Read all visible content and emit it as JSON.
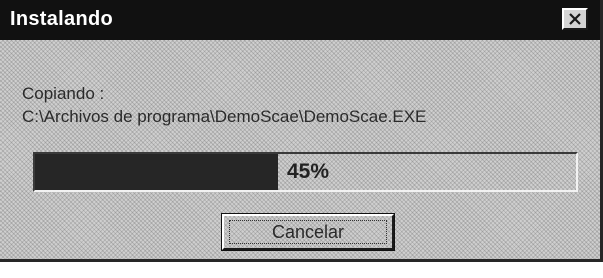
{
  "window": {
    "title": "Instalando",
    "close_icon": "close-icon"
  },
  "body": {
    "status_label": "Copiando :",
    "current_file": "C:\\Archivos de programa\\DemoScae\\DemoScae.EXE"
  },
  "progress": {
    "value": 0.45,
    "label": "45%"
  },
  "buttons": {
    "cancel_label": "Cancelar"
  },
  "colors": {
    "title_bar": "#111111",
    "progress_fill": "#262626",
    "dialog_face": "#cfcfcf"
  }
}
